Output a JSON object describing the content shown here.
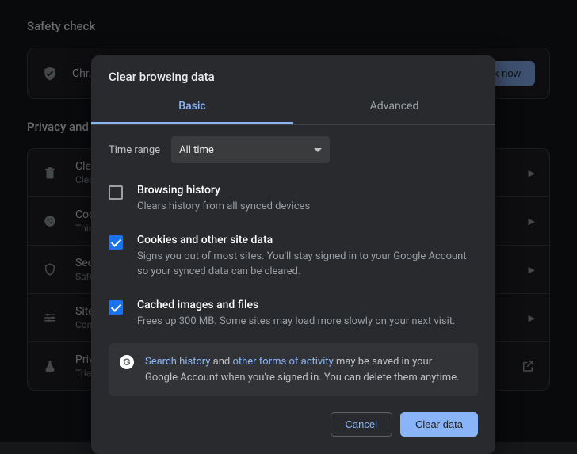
{
  "page": {
    "safety_title": "Safety check",
    "safety_row": "Chr…",
    "check_now": "eck now",
    "privacy_title": "Privacy and s…",
    "rows": [
      {
        "title": "Clea…",
        "sub": "Clea…",
        "icon": "trash"
      },
      {
        "title": "Cook…",
        "sub": "Third…",
        "icon": "cookie"
      },
      {
        "title": "Secu…",
        "sub": "Safe…",
        "icon": "shield"
      },
      {
        "title": "Site …",
        "sub": "Cont…",
        "icon": "sliders"
      },
      {
        "title": "Priva…",
        "sub": "Trial…",
        "icon": "flask"
      }
    ]
  },
  "dialog": {
    "title": "Clear browsing data",
    "tabs": {
      "basic": "Basic",
      "advanced": "Advanced"
    },
    "range_label": "Time range",
    "range_value": "All time",
    "options": [
      {
        "title": "Browsing history",
        "sub": "Clears history from all synced devices",
        "checked": false
      },
      {
        "title": "Cookies and other site data",
        "sub": "Signs you out of most sites. You'll stay signed in to your Google Account so your synced data can be cleared.",
        "checked": true
      },
      {
        "title": "Cached images and files",
        "sub": "Frees up 300 MB. Some sites may load more slowly on your next visit.",
        "checked": true
      }
    ],
    "info": {
      "link1": "Search history",
      "mid1": " and ",
      "link2": "other forms of activity",
      "tail": " may be saved in your Google Account when you're signed in. You can delete them anytime."
    },
    "buttons": {
      "cancel": "Cancel",
      "clear": "Clear data"
    }
  }
}
